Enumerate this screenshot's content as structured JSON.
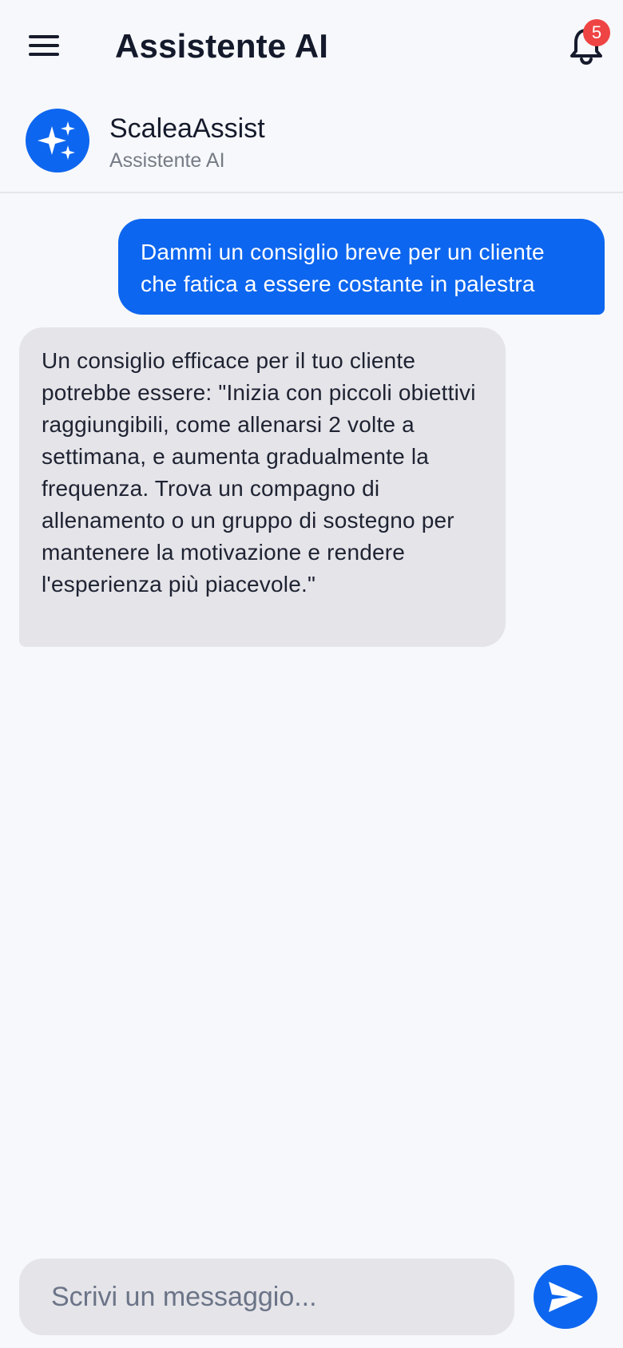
{
  "header": {
    "title": "Assistente AI",
    "notification_count": "5"
  },
  "assistant": {
    "name": "ScaleaAssist",
    "role": "Assistente AI"
  },
  "messages": [
    {
      "sender": "user",
      "text": "Dammi un consiglio breve per un cliente che fatica a essere costante in palestra"
    },
    {
      "sender": "assistant",
      "text": "Un consiglio efficace per il tuo cliente potrebbe essere: \"Inizia con piccoli obiettivi raggiungibili, come allenarsi 2 volte a settimana, e aumenta gradualmente la frequenza. Trova un compagno di allenamento o un gruppo di sostegno per mantenere la motivazione e rendere l'esperienza più piacevole.\""
    }
  ],
  "composer": {
    "placeholder": "Scrivi un messaggio..."
  },
  "icons": {
    "menu": "hamburger-menu-icon",
    "notifications": "bell-icon",
    "assistant_avatar": "sparkles-icon",
    "send": "paper-plane-send-icon"
  },
  "colors": {
    "accent": "#0d66ef",
    "badge": "#ef4444",
    "background": "#f6f8fb",
    "bot_bubble": "#e4e4e9"
  }
}
